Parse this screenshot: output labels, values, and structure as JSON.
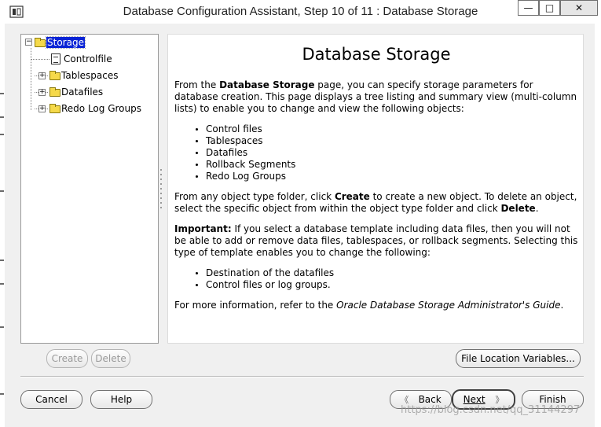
{
  "window": {
    "title": "Database Configuration Assistant, Step 10 of 11 : Database Storage",
    "minimize_glyph": "—",
    "maximize_glyph": "□",
    "close_glyph": "✕"
  },
  "tree": {
    "root": {
      "label": "Storage",
      "expander": "−"
    },
    "children": [
      {
        "label": "Controlfile"
      },
      {
        "label": "Tablespaces",
        "expander": "+"
      },
      {
        "label": "Datafiles",
        "expander": "+"
      },
      {
        "label": "Redo Log Groups",
        "expander": "+"
      }
    ]
  },
  "content": {
    "title": "Database Storage",
    "intro_pre": "From the ",
    "intro_bold": "Database Storage",
    "intro_post": " page, you can specify storage parameters for database creation. This page displays a tree listing and summary view (multi-column lists) to enable you to change and view the following objects:",
    "objects": [
      "Control files",
      "Tablespaces",
      "Datafiles",
      "Rollback Segments",
      "Redo Log Groups"
    ],
    "create_pre": "From any object type folder, click ",
    "create_bold": "Create",
    "create_mid": " to create a new object. To delete an object, select the specific object from within the object type folder and click ",
    "delete_bold": "Delete",
    "create_end": ".",
    "important_bold": "Important:",
    "important_text": " If you select a database template including data files, then you will not be able to add or remove data files, tablespaces, or rollback segments. Selecting this type of template enables you to change the following:",
    "changeable": [
      "Destination of the datafiles",
      "Control files or log groups."
    ],
    "more_pre": "For more information, refer to the ",
    "more_italic": "Oracle Database Storage Administrator's Guide",
    "more_end": "."
  },
  "buttons": {
    "create": "Create",
    "delete": "Delete",
    "file_location": "File Location Variables...",
    "cancel": "Cancel",
    "help": "Help",
    "back": "Back",
    "next": "Next",
    "finish": "Finish",
    "back_arrow": "《",
    "next_arrow": "》"
  },
  "watermark": "https://blog.csdn.net/qq_31144297"
}
